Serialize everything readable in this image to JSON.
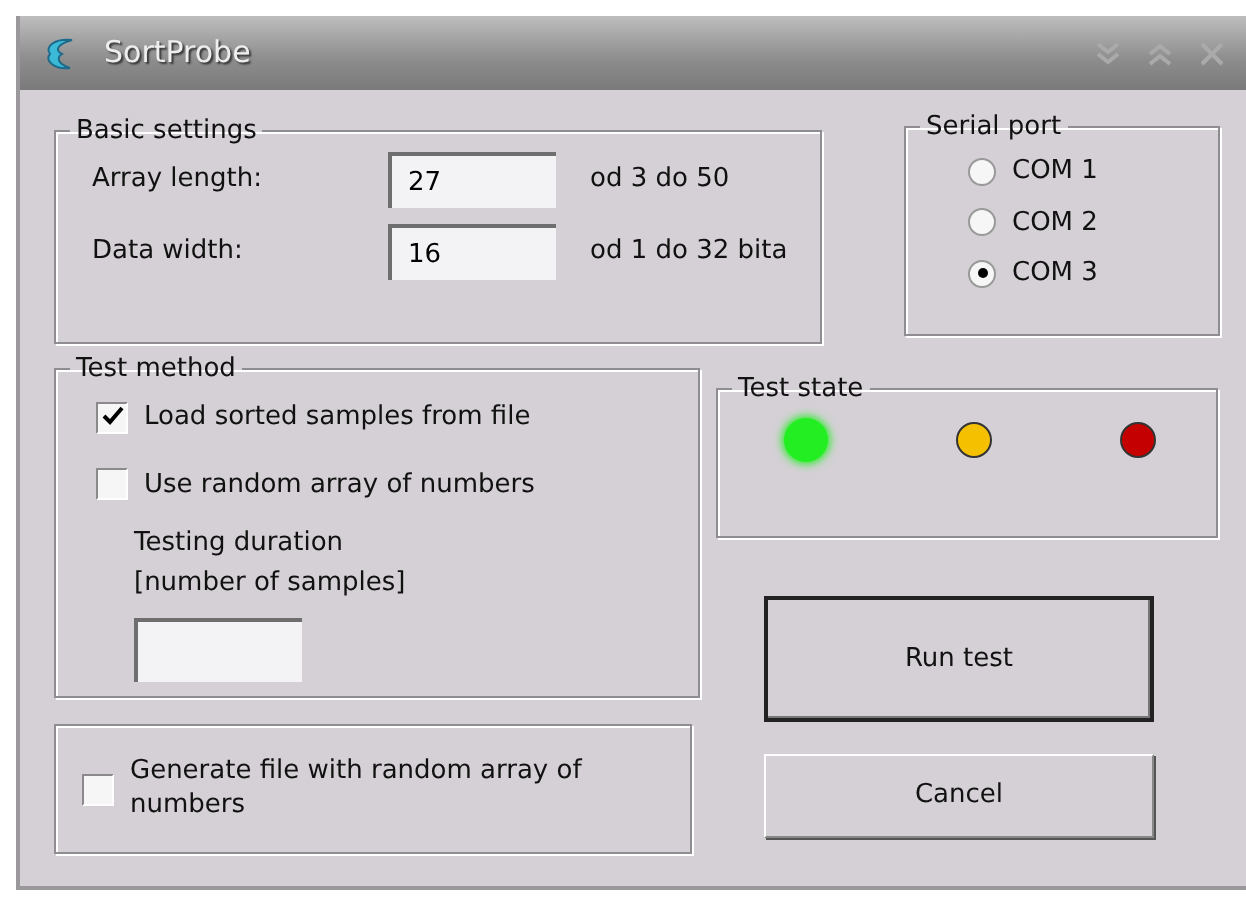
{
  "window": {
    "title": "SortProbe"
  },
  "basic_settings": {
    "title": "Basic settings",
    "fields": [
      {
        "label": "Array length:",
        "value": "27",
        "hint": "od 3 do 50"
      },
      {
        "label": "Data width:",
        "value": "16",
        "hint": "od 1 do 32 bita"
      }
    ]
  },
  "serial_port": {
    "title": "Serial port",
    "options": [
      {
        "label": "COM 1",
        "selected": false
      },
      {
        "label": "COM 2",
        "selected": false
      },
      {
        "label": "COM 3",
        "selected": true
      }
    ]
  },
  "test_method": {
    "title": "Test method",
    "options": [
      {
        "label": "Load sorted samples from file",
        "checked": true
      },
      {
        "label": "Use random array of numbers",
        "checked": false
      }
    ],
    "duration_label": "Testing duration",
    "duration_sublabel": "[number of samples]"
  },
  "generate": {
    "label": "Generate file with random array of numbers",
    "checked": false
  },
  "test_state": {
    "title": "Test state",
    "lights": [
      {
        "color": "#22ee22",
        "on": true
      },
      {
        "color": "#f5c000",
        "on": false
      },
      {
        "color": "#c40000",
        "on": false
      }
    ]
  },
  "buttons": [
    {
      "label": "Run test",
      "default": true
    },
    {
      "label": "Cancel",
      "default": false
    }
  ]
}
